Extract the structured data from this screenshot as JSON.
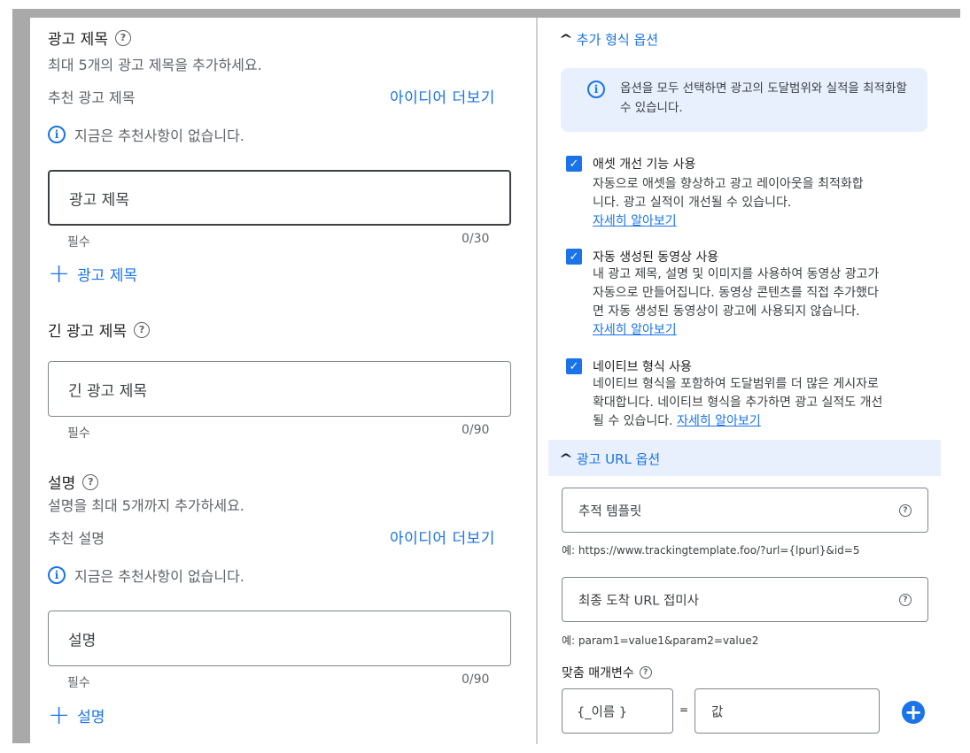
{
  "left": {
    "headline": {
      "title": "광고 제목",
      "subtitle": "최대 5개의 광고 제목을 추가하세요.",
      "recommended_label": "추천 광고 제목",
      "ideas_link": "아이디어 더보기",
      "no_recommendations": "지금은 추천사항이 없습니다.",
      "input_placeholder": "광고 제목",
      "required": "필수",
      "counter": "0/30",
      "add_label": "광고 제목"
    },
    "long_headline": {
      "title": "긴 광고 제목",
      "input_placeholder": "긴 광고 제목",
      "required": "필수",
      "counter": "0/90"
    },
    "description": {
      "title": "설명",
      "subtitle": "설명을 최대 5개까지 추가하세요.",
      "recommended_label": "추천 설명",
      "ideas_link": "아이디어 더보기",
      "no_recommendations": "지금은 추천사항이 없습니다.",
      "input_placeholder": "설명",
      "required": "필수",
      "counter": "0/90",
      "add_label": "설명"
    }
  },
  "right": {
    "format_options": {
      "title": "추가 형식 옵션",
      "notice": "옵션을 모두 선택하면 광고의 도달범위와 실적을 최적화할 수 있습니다.",
      "options": [
        {
          "title": "애셋 개선 기능 사용",
          "desc_line1": "자동으로 애셋을 향상하고 광고 레이아웃을 최적화합",
          "desc_line2": "니다. 광고 실적이 개선될 수 있습니다.",
          "learn_more": "자세히 알아보기",
          "checked": true
        },
        {
          "title": "자동 생성된 동영상 사용",
          "desc_line1": "내 광고 제목, 설명 및 이미지를 사용하여 동영상 광고가",
          "desc_line2": "자동으로 만들어집니다. 동영상 콘텐츠를 직접 추가했다",
          "desc_line3": "면 자동 생성된 동영상이 광고에 사용되지 않습니다.",
          "learn_more": "자세히 알아보기",
          "checked": true
        },
        {
          "title": "네이티브 형식 사용",
          "desc_line1": "네이티브 형식을 포함하여 도달범위를 더 많은 게시자로",
          "desc_line2": "확대합니다. 네이티브 형식을 추가하면 광고 실적도 개선",
          "desc_line3": "될 수 있습니다.",
          "learn_more": "자세히 알아보기",
          "checked": true
        }
      ]
    },
    "url_options": {
      "title": "광고 URL 옵션",
      "tracking_placeholder": "추적 템플릿",
      "tracking_example": "예: https://www.trackingtemplate.foo/?url={lpurl}&id=5",
      "suffix_placeholder": "최종 도착 URL 접미사",
      "suffix_example": "예: param1=value1&param2=value2",
      "custom_params_title": "맞춤 매개변수",
      "param_name_placeholder": "{_이름       }",
      "equals": "=",
      "param_value_placeholder": "값"
    }
  },
  "icons": {
    "help": "?",
    "info": "i",
    "check": "✓",
    "chevron": "^",
    "plus": "+"
  },
  "colors": {
    "accent": "#1a73e8",
    "notice_bg": "#e8f0fe"
  }
}
